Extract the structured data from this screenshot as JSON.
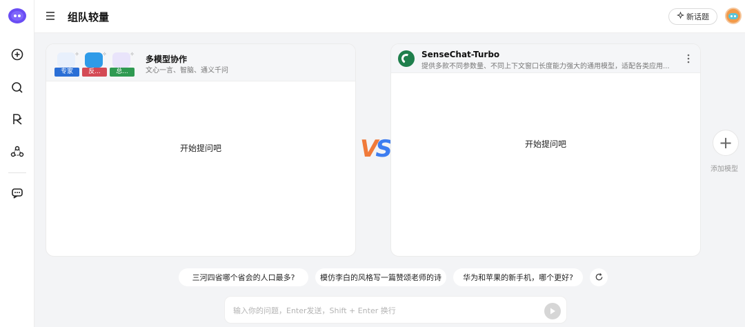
{
  "header": {
    "title": "组队较量",
    "new_topic_label": "新话题"
  },
  "left_panel": {
    "name": "多模型协作",
    "desc": "文心一言、智脑、通义千问",
    "bots": [
      {
        "badge": "专家",
        "color": "#2b6fd6",
        "pic_color": "#e8f0fc"
      },
      {
        "badge": "反...",
        "color": "#d44a55",
        "pic_color": "#2f9be8"
      },
      {
        "badge": "总...",
        "color": "#2f9a52",
        "pic_color": "#e9e4fb"
      }
    ],
    "empty_text": "开始提问吧"
  },
  "vs": {
    "v": "V",
    "s": "S"
  },
  "right_panel": {
    "name": "SenseChat-Turbo",
    "desc": "提供多款不同参数量、不同上下文窗口长度能力强大的通用模型，适配各类应用...",
    "empty_text": "开始提问吧"
  },
  "add_model": {
    "symbol": "+",
    "label": "添加模型"
  },
  "suggestions": [
    "三河四省哪个省会的人口最多?",
    "模仿李白的风格写一篇赞颂老师的诗",
    "华为和苹果的新手机，哪个更好?"
  ],
  "input": {
    "placeholder": "输入你的问题，Enter发送，Shift + Enter 换行",
    "value": ""
  },
  "colors": {
    "accent": "#6a4df4",
    "vs_orange": "#f07a3a",
    "vs_blue": "#3d7df0"
  }
}
